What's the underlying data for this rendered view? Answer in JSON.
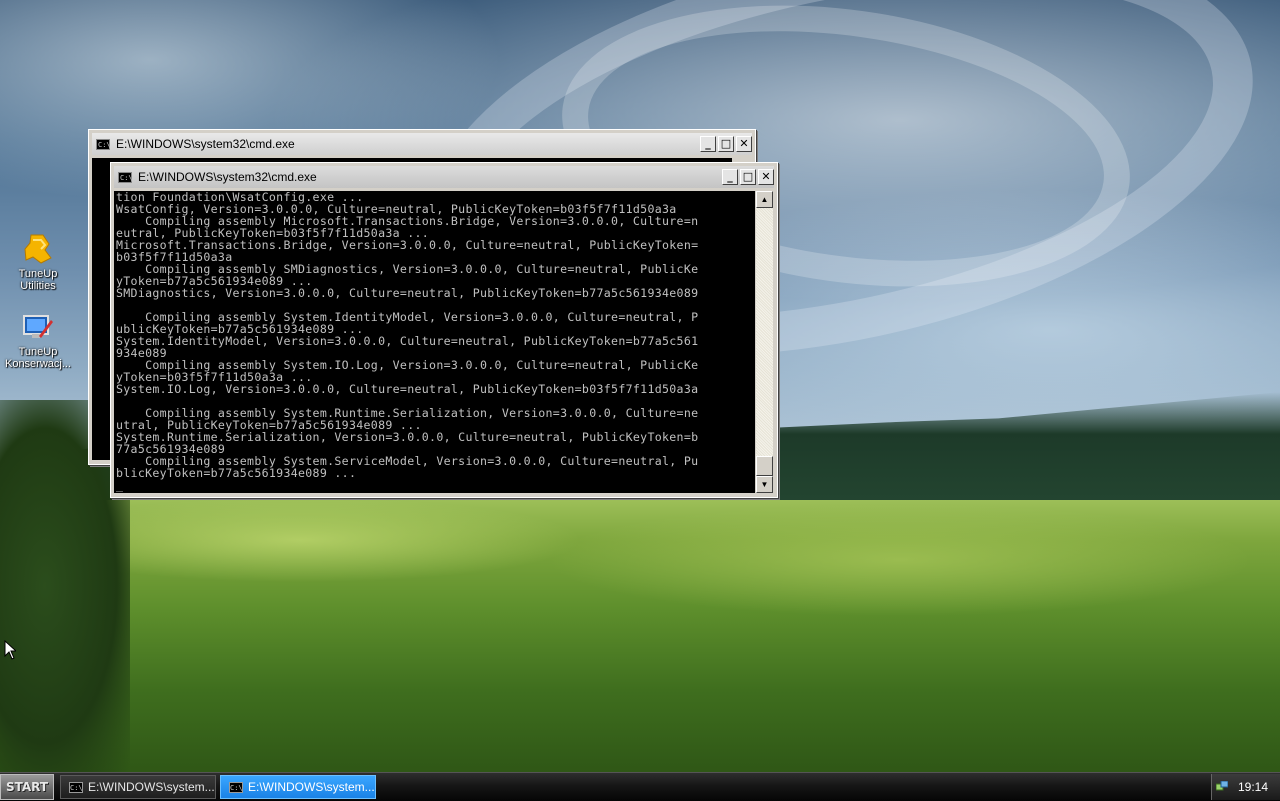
{
  "desktop": {
    "icons": [
      {
        "label_line1": "TuneUp",
        "label_line2": "Utilities",
        "icon": "tuneup-utilities-icon"
      },
      {
        "label_line1": "TuneUp",
        "label_line2": "Konserwacj...",
        "icon": "tuneup-maintenance-icon"
      }
    ]
  },
  "windows": {
    "back": {
      "title": "E:\\WINDOWS\\system32\\cmd.exe",
      "icon_text": "C:\\"
    },
    "front": {
      "title": "E:\\WINDOWS\\system32\\cmd.exe",
      "icon_text": "C:\\",
      "console_text": "tion Foundation\\WsatConfig.exe ...\nWsatConfig, Version=3.0.0.0, Culture=neutral, PublicKeyToken=b03f5f7f11d50a3a\n    Compiling assembly Microsoft.Transactions.Bridge, Version=3.0.0.0, Culture=n\neutral, PublicKeyToken=b03f5f7f11d50a3a ...\nMicrosoft.Transactions.Bridge, Version=3.0.0.0, Culture=neutral, PublicKeyToken=\nb03f5f7f11d50a3a\n    Compiling assembly SMDiagnostics, Version=3.0.0.0, Culture=neutral, PublicKe\nyToken=b77a5c561934e089 ...\nSMDiagnostics, Version=3.0.0.0, Culture=neutral, PublicKeyToken=b77a5c561934e089\n\n    Compiling assembly System.IdentityModel, Version=3.0.0.0, Culture=neutral, P\nublicKeyToken=b77a5c561934e089 ...\nSystem.IdentityModel, Version=3.0.0.0, Culture=neutral, PublicKeyToken=b77a5c561\n934e089\n    Compiling assembly System.IO.Log, Version=3.0.0.0, Culture=neutral, PublicKe\nyToken=b03f5f7f11d50a3a ...\nSystem.IO.Log, Version=3.0.0.0, Culture=neutral, PublicKeyToken=b03f5f7f11d50a3a\n\n    Compiling assembly System.Runtime.Serialization, Version=3.0.0.0, Culture=ne\nutral, PublicKeyToken=b77a5c561934e089 ...\nSystem.Runtime.Serialization, Version=3.0.0.0, Culture=neutral, PublicKeyToken=b\n77a5c561934e089\n    Compiling assembly System.ServiceModel, Version=3.0.0.0, Culture=neutral, Pu\nblicKeyToken=b77a5c561934e089 ...\n_"
    },
    "controls": {
      "minimize": "_",
      "maximize": "□",
      "close": "✕"
    }
  },
  "taskbar": {
    "start_label": "START",
    "tasks": [
      {
        "label": "E:\\WINDOWS\\system...",
        "active": false
      },
      {
        "label": "E:\\WINDOWS\\system...",
        "active": true
      }
    ],
    "clock": "19:14"
  },
  "colors": {
    "console_bg": "#000000",
    "console_fg": "#c0c0c0",
    "task_active": "#1a82e6"
  }
}
